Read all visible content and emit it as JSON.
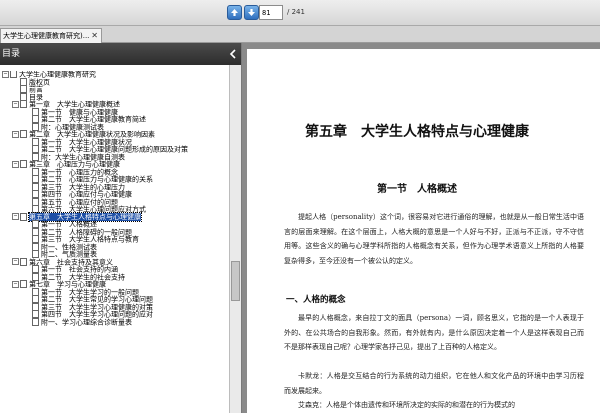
{
  "toolbar": {
    "up_icon": "arrow-up-icon",
    "down_icon": "arrow-down-icon",
    "page_number": "81",
    "page_total": "/ 241"
  },
  "tab": {
    "title": "大学生心理健康教育研究)...",
    "close": "✕"
  },
  "sidebar": {
    "header": "目录",
    "items": [
      {
        "level": 0,
        "label": "大学生心理健康教育研究",
        "expander": "−"
      },
      {
        "level": 1,
        "label": "版权页"
      },
      {
        "level": 1,
        "label": "前言"
      },
      {
        "level": 1,
        "label": "目录"
      },
      {
        "level": 1,
        "label": "第一章　大学生心理健康概述",
        "expander": "−"
      },
      {
        "level": 2,
        "label": "第一节　健康与心理健康"
      },
      {
        "level": 2,
        "label": "第二节　大学生心理健康教育简述"
      },
      {
        "level": 2,
        "label": "附：心理健康测试表"
      },
      {
        "level": 1,
        "label": "第二章　大学生心理健康状况及影响因素",
        "expander": "−"
      },
      {
        "level": 2,
        "label": "第一节　大学生心理健康状况"
      },
      {
        "level": 2,
        "label": "第二节　大学生心理健康问题形成的原因及对策"
      },
      {
        "level": 2,
        "label": "附：大学生心理健康自测表"
      },
      {
        "level": 1,
        "label": "第三章　心理压力与心理健康",
        "expander": "−"
      },
      {
        "level": 2,
        "label": "第一节　心理压力的概念"
      },
      {
        "level": 2,
        "label": "第二节　心理压力与心理健康的关系"
      },
      {
        "level": 2,
        "label": "第三节　大学生的心理压力"
      },
      {
        "level": 2,
        "label": "第四节　心理应付与心理健康"
      },
      {
        "level": 2,
        "label": "第五节　心理应付的问题"
      },
      {
        "level": 2,
        "label": "第六节　大学生心理问题应对方式"
      },
      {
        "level": 1,
        "label": "第五章　大学生人格特点与心理健康",
        "expander": "−",
        "selected": true
      },
      {
        "level": 2,
        "label": "第一节　人格概述"
      },
      {
        "level": 2,
        "label": "第二节　人格障碍的一般问题"
      },
      {
        "level": 2,
        "label": "第三节　大学生人格特点与教育"
      },
      {
        "level": 2,
        "label": "附一、性格测试表"
      },
      {
        "level": 2,
        "label": "附二、气质测量表"
      },
      {
        "level": 1,
        "label": "第六章　社会支持及其意义",
        "expander": "−"
      },
      {
        "level": 2,
        "label": "第一节　社会支持的内涵"
      },
      {
        "level": 2,
        "label": "第二节　大学生的社会支持"
      },
      {
        "level": 1,
        "label": "第七章　学习与心理健康",
        "expander": "−"
      },
      {
        "level": 2,
        "label": "第一节　大学生学习的一般问题"
      },
      {
        "level": 2,
        "label": "第二节　大学生常见的学习心理问题"
      },
      {
        "level": 2,
        "label": "第三节　大学生学习心理健康的对策"
      },
      {
        "level": 2,
        "label": "第四节　大学生学习心理问题的应对"
      },
      {
        "level": 2,
        "label": "附一、学习心理综合诊断量表"
      }
    ]
  },
  "page": {
    "chapter_title": "第五章　大学生人格特点与心理健康",
    "section_title": "第一节　人格概述",
    "para1": "提起人格（personality）这个词，很容易对它进行通俗的理解，也就是从一般日常生活中语言的层面来理解。在这个层面上，人格大概的意思是一个人好与不好，正派与不正派，守不守信用等。这些含义的确与心理学科所指的人格概念有关系，但作为心理学术语意义上所指的人格要复杂得多，至今还没有一个被公认的定义。",
    "subhead1": "一、人格的概念",
    "para2": "最早的人格概念，来自拉丁文的面具（persona）一词，顾名思义，它指的是一个人表现于外的、在公共场合的自我形象。然而，有外就有内，是什么原因决定着一个人是这样表现自己而不是那样表现自己呢？心理学家各抒己见，提出了上百种的人格定义。",
    "para3": "卡默龙：人格是交互结合的行为系统的动力组织，它在他人和文化产品的环境中由学习历程而发展起来。",
    "para4": "艾森克：人格是个体由遗传和环境所决定的实际的和潜在的行为模式的"
  }
}
